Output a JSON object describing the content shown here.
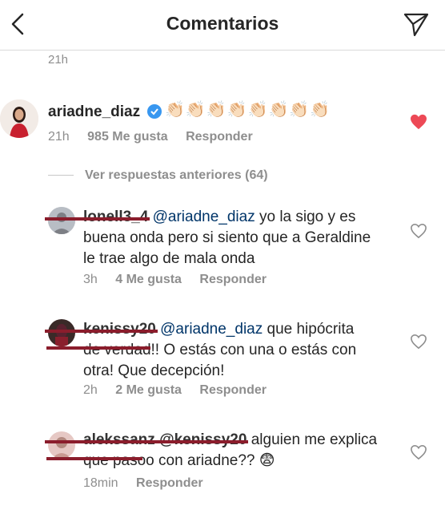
{
  "header": {
    "title": "Comentarios"
  },
  "top_time": "21h",
  "main_comment": {
    "username": "ariadne_diaz",
    "emoji_text": "👏🏻👏🏻👏🏻👏🏻👏🏻👏🏻👏🏻👏🏻",
    "time": "21h",
    "likes": "985 Me gusta",
    "reply": "Responder"
  },
  "view_previous": "Ver respuestas anteriores (64)",
  "replies": [
    {
      "username": "lonell3_4",
      "mention": "@ariadne_diaz",
      "text_line1": " yo la sigo y es",
      "text_line2": "buena onda pero si siento que a Geraldine",
      "text_line3": "le trae algo de mala onda",
      "time": "3h",
      "likes": "4 Me gusta",
      "reply": "Responder"
    },
    {
      "username": "kenissy20",
      "mention": "@ariadne_diaz",
      "text_line1": " que hipócrita",
      "text_line2": "de verdad!! O estás con una o estás con",
      "text_line3": "otra! Que decepción!",
      "time": "2h",
      "likes": "2 Me gusta",
      "reply": "Responder"
    },
    {
      "username": "alekssanz @kenissy20",
      "text_line1": " alguien me explica",
      "text_line2": "que pasoo con ariadne?? 😨",
      "time": "18min",
      "reply": "Responder"
    }
  ],
  "colors": {
    "heart_liked": "#ed4956",
    "verified": "#3897f0",
    "redaction": "#8b1d2c"
  }
}
